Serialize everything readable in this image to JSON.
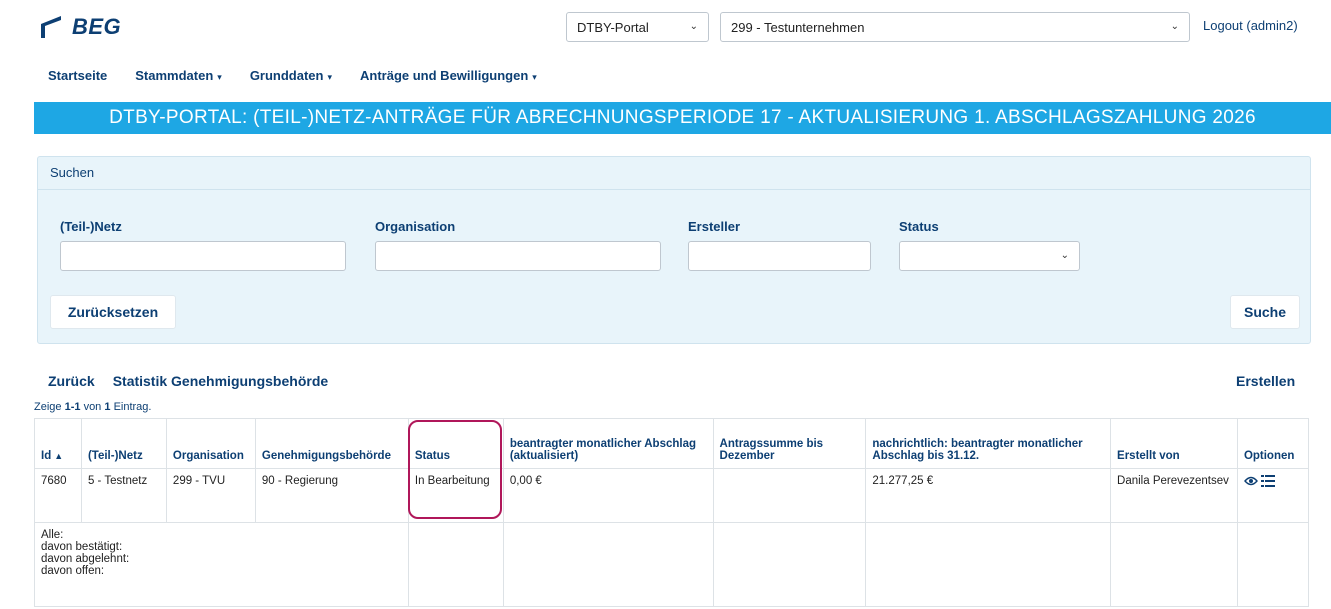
{
  "header": {
    "logo_text": "BEG",
    "portal_select": "DTBY-Portal",
    "company_select": "299 - Testunternehmen",
    "logout": "Logout (admin2)"
  },
  "nav": {
    "home": "Startseite",
    "stammdaten": "Stammdaten",
    "grunddaten": "Grunddaten",
    "antraege": "Anträge und Bewilligungen"
  },
  "banner": "DTBY-PORTAL: (TEIL-)NETZ-ANTRÄGE FÜR ABRECHNUNGSPERIODE 17 - AKTUALISIERUNG 1. ABSCHLAGSZAHLUNG 2026",
  "search": {
    "title": "Suchen",
    "fields": {
      "netz": {
        "label": "(Teil-)Netz",
        "value": ""
      },
      "organisation": {
        "label": "Organisation",
        "value": ""
      },
      "ersteller": {
        "label": "Ersteller",
        "value": ""
      },
      "status": {
        "label": "Status",
        "value": ""
      }
    },
    "reset": "Zurücksetzen",
    "submit": "Suche"
  },
  "actions": {
    "back": "Zurück",
    "stats": "Statistik Genehmigungsbehörde",
    "create": "Erstellen"
  },
  "summary": {
    "prefix": "Zeige",
    "range": "1-1",
    "of": "von",
    "total": "1",
    "suffix": "Eintrag."
  },
  "table": {
    "headers": {
      "id": "Id",
      "netz": "(Teil-)Netz",
      "organisation": "Organisation",
      "behoerde": "Genehmigungsbehörde",
      "status": "Status",
      "abschlag": "beantragter monatlicher Abschlag (aktualisiert)",
      "summe": "Antragssumme bis Dezember",
      "nachrichtlich": "nachrichtlich: beantragter monatlicher Abschlag bis 31.12.",
      "erstellt": "Erstellt von",
      "optionen": "Optionen"
    },
    "row": {
      "id": "7680",
      "netz": "5 - Testnetz",
      "organisation": "299 - TVU",
      "behoerde": "90 - Regierung",
      "status": "In Bearbeitung",
      "abschlag": "0,00 €",
      "summe": "",
      "nachrichtlich": "21.277,25 €",
      "erstellt": "Danila Perevezentsev"
    },
    "totals": {
      "alle": "Alle:",
      "bestaetigt": "davon bestätigt:",
      "abgelehnt": "davon abgelehnt:",
      "offen": "davon offen:"
    }
  },
  "colors": {
    "brand": "#0d3f73",
    "banner": "#1ea7e4",
    "panel": "#e8f4fa",
    "highlight": "#b0175a"
  }
}
